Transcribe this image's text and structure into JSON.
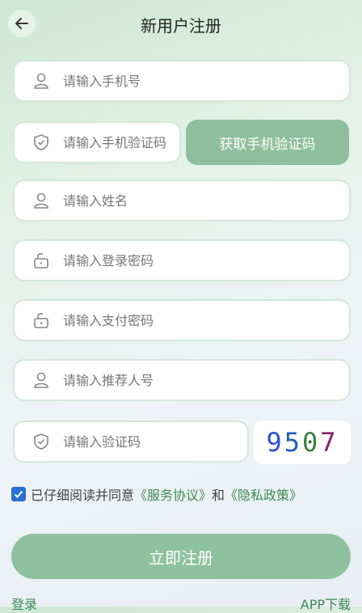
{
  "header": {
    "title": "新用户注册"
  },
  "fields": {
    "phone": {
      "placeholder": "请输入手机号",
      "icon": "user-icon"
    },
    "sms_code": {
      "placeholder": "请输入手机验证码",
      "icon": "shield-check-icon"
    },
    "name": {
      "placeholder": "请输入姓名",
      "icon": "user-icon"
    },
    "login_password": {
      "placeholder": "请输入登录密码",
      "icon": "lock-icon"
    },
    "pay_password": {
      "placeholder": "请输入支付密码",
      "icon": "lock-icon"
    },
    "referrer": {
      "placeholder": "请输入推荐人号",
      "icon": "user-icon"
    },
    "captcha": {
      "placeholder": "请输入验证码",
      "icon": "shield-check-icon"
    }
  },
  "sms_button": {
    "label": "获取手机验证码"
  },
  "captcha_image": {
    "chars": [
      "9",
      "5",
      "0",
      "7"
    ],
    "colors": [
      "#2b4fd8",
      "#1f5fb8",
      "#3d7a3d",
      "#8a1f6a"
    ]
  },
  "agreement": {
    "checked": true,
    "prefix": "已仔细阅读并同意",
    "service_link": "《服务协议》",
    "and": "和",
    "privacy_link": "《隐私政策》"
  },
  "submit_button": {
    "label": "立即注册"
  },
  "footer": {
    "login_link": "登录",
    "download_link": "APP下载"
  },
  "colors": {
    "accent": "#8ec19d",
    "link": "#3f8a55",
    "checkbox": "#2a6fd6"
  }
}
